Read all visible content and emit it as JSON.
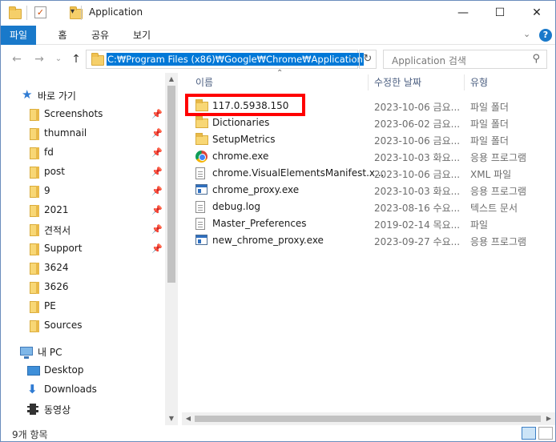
{
  "window": {
    "title": "Application",
    "minimize": "—",
    "maximize": "☐",
    "close": "✕"
  },
  "ribbon": {
    "tabs": [
      "파일",
      "홈",
      "공유",
      "보기"
    ],
    "expand": "⌄",
    "help": "?"
  },
  "address": {
    "back": "←",
    "forward": "→",
    "recent": "⌄",
    "up": "↑",
    "path": "C:₩Program Files (x86)₩Google₩Chrome₩Application",
    "dropdown": "⌄",
    "refresh": "↻",
    "search_placeholder": "Application 검색",
    "search_icon": "⚲"
  },
  "nav": {
    "quick_access": "바로 가기",
    "items": [
      {
        "label": "Screenshots",
        "pinned": true
      },
      {
        "label": "thumnail",
        "pinned": true
      },
      {
        "label": "fd",
        "pinned": true
      },
      {
        "label": "post",
        "pinned": true
      },
      {
        "label": "9",
        "pinned": true
      },
      {
        "label": "2021",
        "pinned": true
      },
      {
        "label": "견적서",
        "pinned": true
      },
      {
        "label": "Support",
        "pinned": true
      },
      {
        "label": "3624",
        "pinned": false
      },
      {
        "label": "3626",
        "pinned": false
      },
      {
        "label": "PE",
        "pinned": false
      },
      {
        "label": "Sources",
        "pinned": false
      }
    ],
    "this_pc": "내 PC",
    "pc_items": [
      "Desktop",
      "Downloads",
      "동영상"
    ],
    "pin_glyph": "📌"
  },
  "columns": {
    "name": "이름",
    "date": "수정한 날짜",
    "type": "유형",
    "sort_glyph": "⌃"
  },
  "files": [
    {
      "name": "117.0.5938.150",
      "date": "2023-10-06 금요...",
      "type": "파일 폴더",
      "icon": "folder"
    },
    {
      "name": "Dictionaries",
      "date": "2023-06-02 금요...",
      "type": "파일 폴더",
      "icon": "folder"
    },
    {
      "name": "SetupMetrics",
      "date": "2023-10-06 금요...",
      "type": "파일 폴더",
      "icon": "folder"
    },
    {
      "name": "chrome.exe",
      "date": "2023-10-03 화요...",
      "type": "응용 프로그램",
      "icon": "chrome"
    },
    {
      "name": "chrome.VisualElementsManifest.x...",
      "date": "2023-10-06 금요...",
      "type": "XML 파일",
      "icon": "doc"
    },
    {
      "name": "chrome_proxy.exe",
      "date": "2023-10-03 화요...",
      "type": "응용 프로그램",
      "icon": "exe"
    },
    {
      "name": "debug.log",
      "date": "2023-08-16 수요...",
      "type": "텍스트 문서",
      "icon": "doc"
    },
    {
      "name": "Master_Preferences",
      "date": "2019-02-14 목요...",
      "type": "파일",
      "icon": "doc"
    },
    {
      "name": "new_chrome_proxy.exe",
      "date": "2023-09-27 수요...",
      "type": "응용 프로그램",
      "icon": "exe"
    }
  ],
  "status": {
    "count": "9개 항목"
  },
  "colors": {
    "accent": "#1979ca",
    "selection": "#0078d7",
    "highlight_box": "#ff0000"
  }
}
